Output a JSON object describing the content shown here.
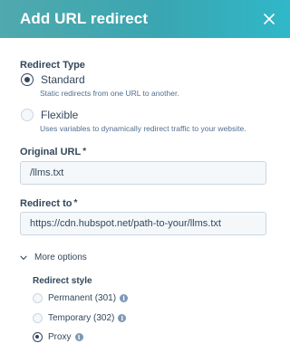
{
  "header": {
    "title": "Add URL redirect",
    "close_icon": "close-icon",
    "gradient_start": "#4fa9ad",
    "gradient_end": "#2fb8c9"
  },
  "redirect_type": {
    "label": "Redirect Type",
    "options": [
      {
        "label": "Standard",
        "description": "Static redirects from one URL to another.",
        "selected": true
      },
      {
        "label": "Flexible",
        "description": "Uses variables to dynamically redirect traffic to your website.",
        "selected": false
      }
    ]
  },
  "original_url": {
    "label": "Original URL",
    "required_mark": "*",
    "value": "/llms.txt"
  },
  "redirect_to": {
    "label": "Redirect to",
    "required_mark": "*",
    "value": "https://cdn.hubspot.net/path-to-your/llms.txt"
  },
  "more_options": {
    "label": "More options",
    "expanded": true,
    "icon": "chevron-down-icon"
  },
  "redirect_style": {
    "label": "Redirect style",
    "options": [
      {
        "label": "Permanent (301)",
        "selected": false,
        "info_icon": "info-icon"
      },
      {
        "label": "Temporary (302)",
        "selected": false,
        "info_icon": "info-icon"
      },
      {
        "label": "Proxy",
        "selected": true,
        "info_icon": "info-icon"
      }
    ]
  },
  "colors": {
    "text": "#33475b",
    "muted_text": "#516f90",
    "input_bg": "#f5f8fa",
    "input_border": "#cbd6e2",
    "info_icon": "#7c98b6"
  }
}
